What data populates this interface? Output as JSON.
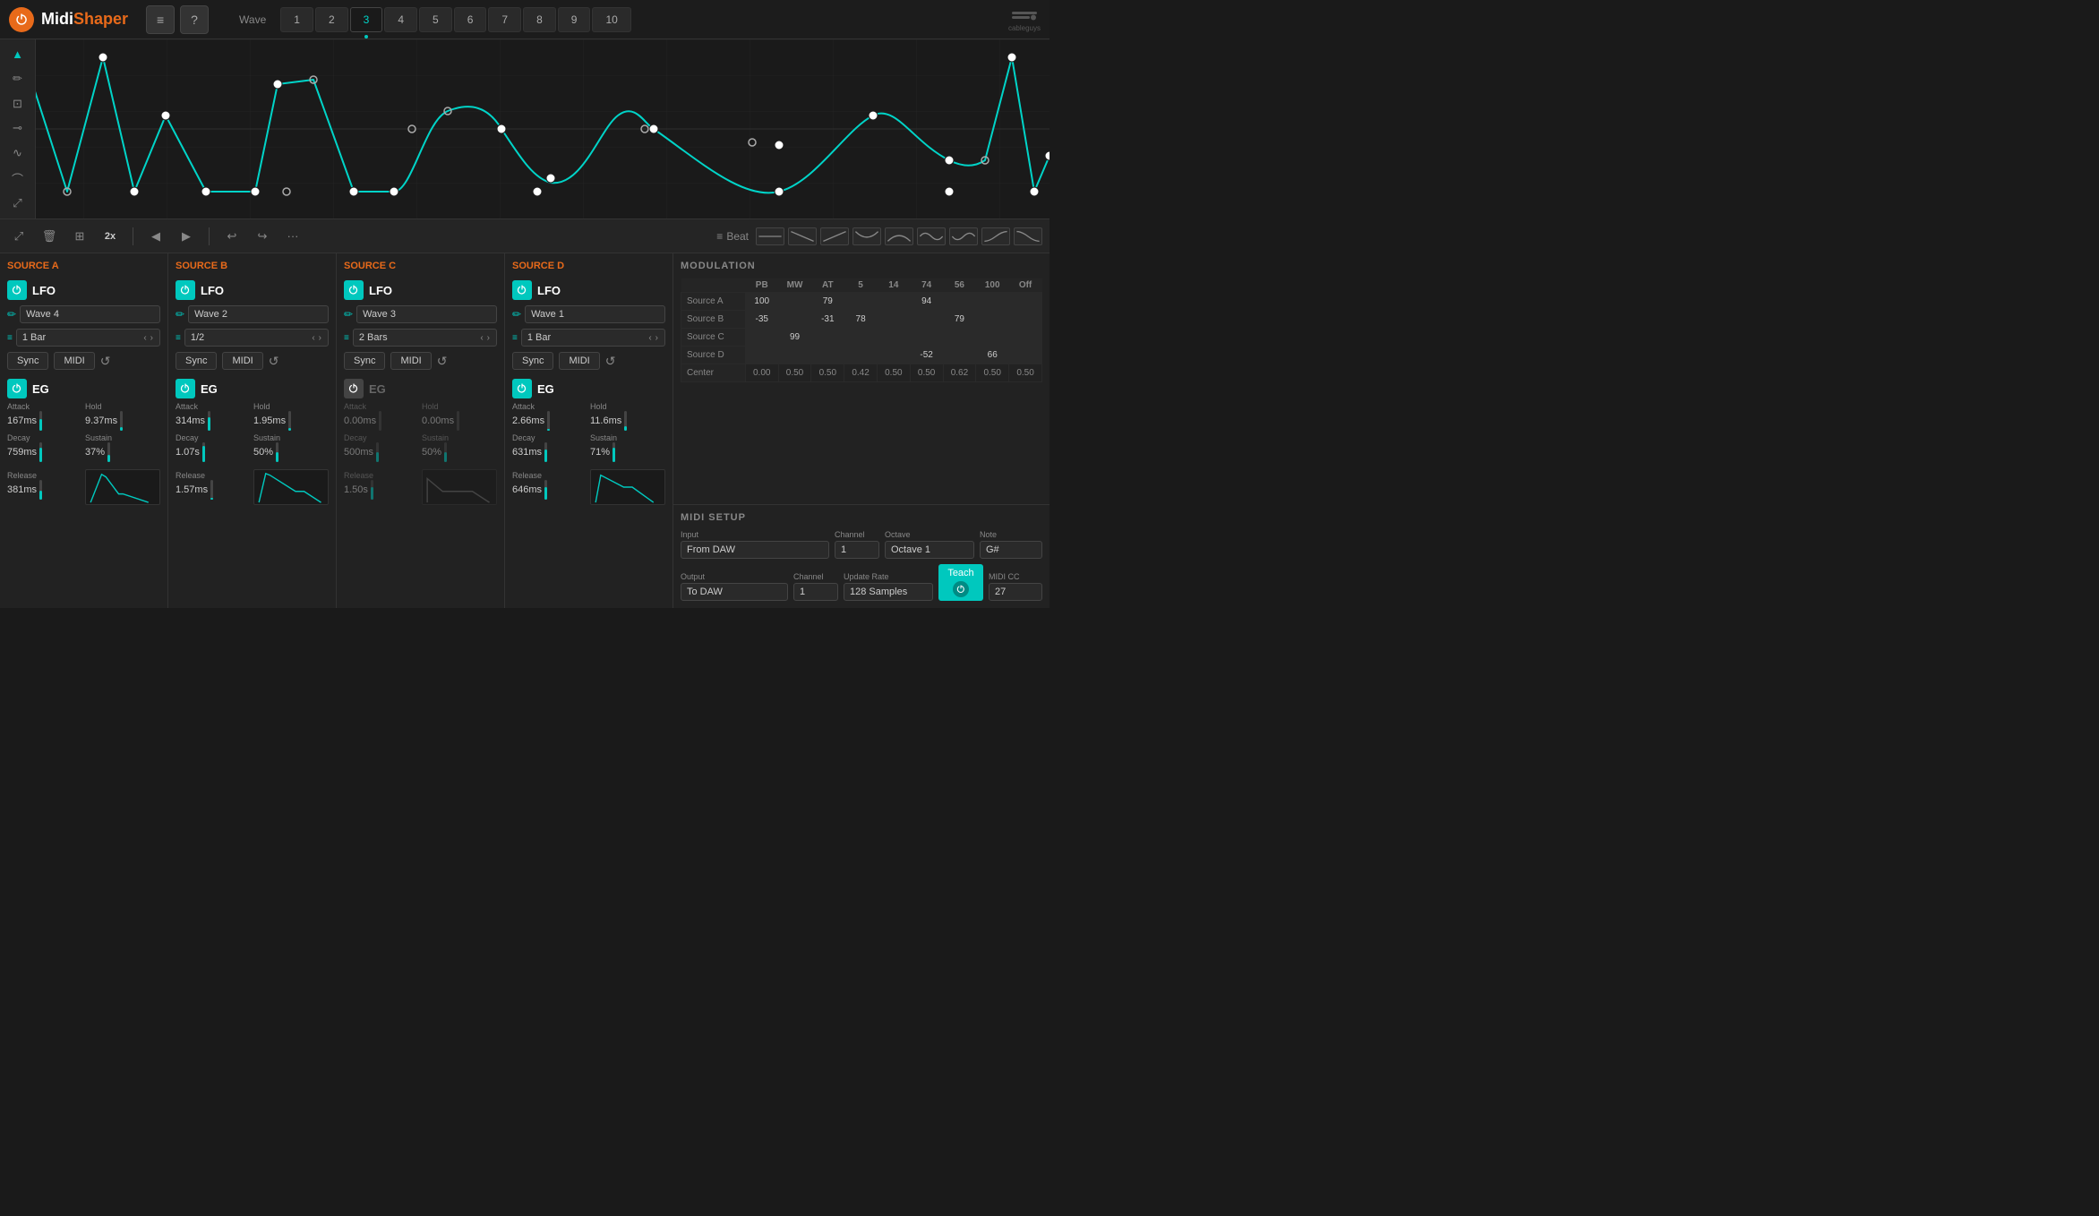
{
  "header": {
    "title": "MidiShaper",
    "title_midi": "Midi",
    "title_shaper": "Shaper",
    "wave_tab_label": "Wave",
    "wave_tabs": [
      "1",
      "2",
      "3",
      "4",
      "5",
      "6",
      "7",
      "8",
      "9",
      "10"
    ],
    "active_tab": "3",
    "cableguys": "cableguys",
    "hamburger": "≡",
    "help": "?"
  },
  "toolbar": {
    "zoom_out": "↙",
    "delete": "🗑",
    "copy": "⊡",
    "multiplier": "2x",
    "prev": "◀",
    "next": "▶",
    "undo": "↩",
    "redo": "↪",
    "more": "···",
    "beat_icon": "≡",
    "beat_label": "Beat",
    "shapes": [
      "─",
      "⌒",
      "⌣",
      "⌣⌣",
      "⌒⌒",
      "⌣⌒",
      "⌒⌣",
      "⌣⌒⌒",
      "⌒⌒⌣"
    ]
  },
  "sources": [
    {
      "id": "A",
      "title": "SOURCE A",
      "lfo_active": true,
      "lfo_label": "LFO",
      "wave_name": "Wave 4",
      "bar_value": "1 Bar",
      "sync_label": "Sync",
      "midi_label": "MIDI",
      "eg_active": true,
      "eg_label": "EG",
      "attack_label": "Attack",
      "attack_value": "167ms",
      "hold_label": "Hold",
      "hold_value": "9.37ms",
      "decay_label": "Decay",
      "decay_value": "759ms",
      "sustain_label": "Sustain",
      "sustain_value": "37%",
      "release_label": "Release",
      "release_value": "381ms"
    },
    {
      "id": "B",
      "title": "SOURCE B",
      "lfo_active": true,
      "lfo_label": "LFO",
      "wave_name": "Wave 2",
      "bar_value": "1/2",
      "sync_label": "Sync",
      "midi_label": "MIDI",
      "eg_active": true,
      "eg_label": "EG",
      "attack_label": "Attack",
      "attack_value": "314ms",
      "hold_label": "Hold",
      "hold_value": "1.95ms",
      "decay_label": "Decay",
      "decay_value": "1.07s",
      "sustain_label": "Sustain",
      "sustain_value": "50%",
      "release_label": "Release",
      "release_value": "1.57ms"
    },
    {
      "id": "C",
      "title": "SOURCE C",
      "lfo_active": true,
      "lfo_label": "LFO",
      "wave_name": "Wave 3",
      "bar_value": "2 Bars",
      "sync_label": "Sync",
      "midi_label": "MIDI",
      "eg_active": false,
      "eg_label": "EG",
      "attack_label": "Attack",
      "attack_value": "0.00ms",
      "hold_label": "Hold",
      "hold_value": "0.00ms",
      "decay_label": "Decay",
      "decay_value": "500ms",
      "sustain_label": "Sustain",
      "sustain_value": "50%",
      "release_label": "Release",
      "release_value": "1.50s"
    },
    {
      "id": "D",
      "title": "SOURCE D",
      "lfo_active": true,
      "lfo_label": "LFO",
      "wave_name": "Wave 1",
      "bar_value": "1 Bar",
      "sync_label": "Sync",
      "midi_label": "MIDI",
      "eg_active": true,
      "eg_label": "EG",
      "attack_label": "Attack",
      "attack_value": "2.66ms",
      "hold_label": "Hold",
      "hold_value": "11.6ms",
      "decay_label": "Decay",
      "decay_value": "631ms",
      "sustain_label": "Sustain",
      "sustain_value": "71%",
      "release_label": "Release",
      "release_value": "646ms"
    }
  ],
  "modulation": {
    "title": "MODULATION",
    "headers": [
      "PB",
      "MW",
      "AT",
      "5",
      "14",
      "74",
      "56",
      "100",
      "Off"
    ],
    "rows": [
      {
        "label": "Source A",
        "cells": [
          "100",
          "",
          "79",
          "",
          "",
          "94",
          "",
          "",
          ""
        ]
      },
      {
        "label": "Source B",
        "cells": [
          "-35",
          "",
          "-31",
          "78",
          "",
          "",
          "79",
          "",
          ""
        ]
      },
      {
        "label": "Source C",
        "cells": [
          "",
          "99",
          "",
          "",
          "",
          "",
          "",
          "",
          ""
        ]
      },
      {
        "label": "Source D",
        "cells": [
          "",
          "",
          "",
          "",
          "",
          "-52",
          "",
          "66",
          ""
        ]
      }
    ],
    "center_label": "Center",
    "center_values": [
      "0.00",
      "0.50",
      "0.50",
      "0.42",
      "0.50",
      "0.50",
      "0.62",
      "0.50",
      "0.50"
    ]
  },
  "midi_setup": {
    "title": "MIDI SETUP",
    "input_label": "Input",
    "input_value": "From DAW",
    "input_channel_label": "Channel",
    "input_channel_value": "1",
    "octave_label": "Octave",
    "octave_value": "Octave 1",
    "note_label": "Note",
    "note_value": "G#",
    "output_label": "Output",
    "output_value": "To DAW",
    "output_channel_label": "Channel",
    "output_channel_value": "1",
    "update_rate_label": "Update Rate",
    "update_rate_value": "128 Samples",
    "teach_label": "Teach",
    "midi_cc_label": "MIDI CC",
    "midi_cc_value": "27"
  }
}
